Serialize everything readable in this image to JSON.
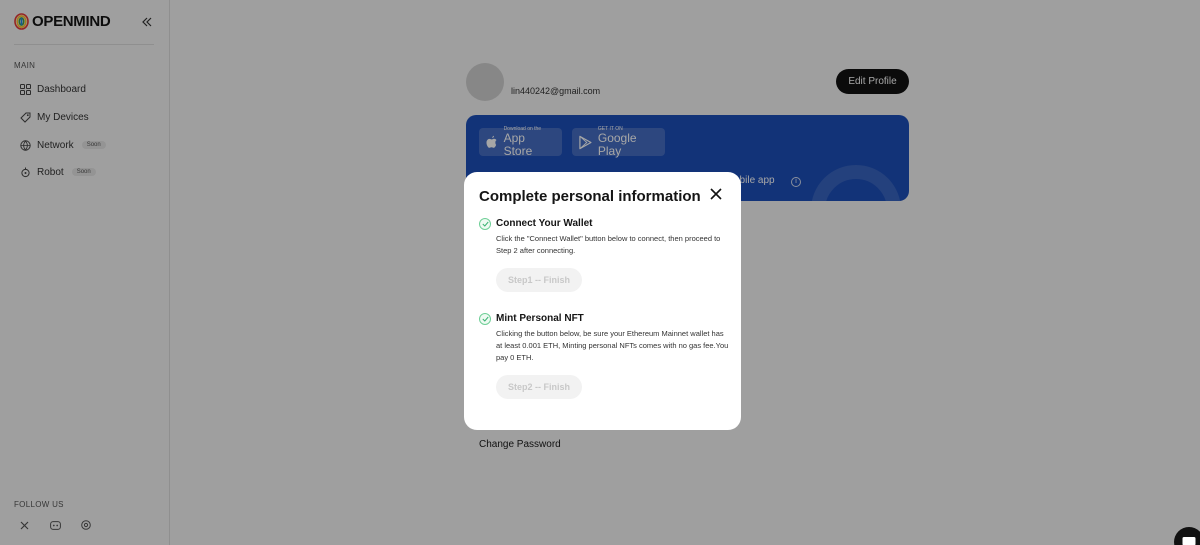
{
  "brand": {
    "name": "OPENMIND"
  },
  "sidebar": {
    "section_main": "MAIN",
    "items": [
      {
        "label": "Dashboard",
        "icon": "grid-icon",
        "badge": ""
      },
      {
        "label": "My Devices",
        "icon": "tag-icon",
        "badge": ""
      },
      {
        "label": "Network",
        "icon": "globe-icon",
        "badge": "Soon"
      },
      {
        "label": "Robot",
        "icon": "robot-icon",
        "badge": "Soon"
      }
    ],
    "section_follow": "FOLLOW US",
    "social": [
      "x-icon",
      "discord-icon",
      "web-icon"
    ]
  },
  "profile": {
    "email": "lin440242@gmail.com",
    "edit_label": "Edit Profile"
  },
  "banner": {
    "app_store": {
      "small": "Download on the",
      "big": "App Store"
    },
    "google_play": {
      "small": "GET IT ON",
      "big": "Google Play"
    },
    "text": "obile app",
    "info_icon": "info-icon"
  },
  "change_password": "Change Password",
  "modal": {
    "title": "Complete personal information",
    "steps": [
      {
        "title": "Connect Your Wallet",
        "description": "Click the \"Connect Wallet\" button below to connect, then proceed to Step 2 after connecting.",
        "button": "Step1 -- Finish"
      },
      {
        "title": "Mint Personal NFT",
        "description": "Clicking the button below, be sure your Ethereum Mainnet wallet has at least 0.001 ETH, Minting personal NFTs comes with no gas fee.You pay 0 ETH.",
        "button": "Step2 -- Finish"
      }
    ]
  },
  "colors": {
    "banner": "#1d4fb8",
    "primary_button": "#121212",
    "check": "#6fcf97"
  }
}
